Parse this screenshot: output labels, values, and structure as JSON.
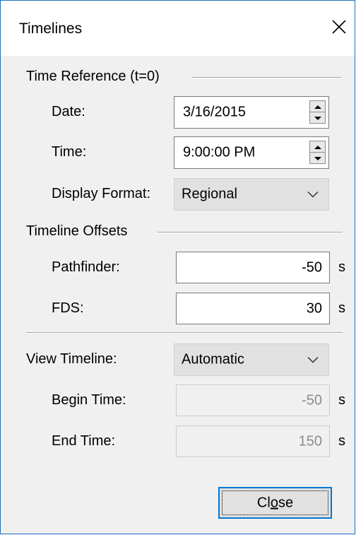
{
  "window": {
    "title": "Timelines",
    "close_icon": "close-icon"
  },
  "time_reference": {
    "header": "Time Reference (t=0)",
    "date_label": "Date:",
    "date_value": "3/16/2015",
    "time_label": "Time:",
    "time_value": "9:00:00 PM",
    "display_format_label": "Display Format:",
    "display_format_value": "Regional"
  },
  "timeline_offsets": {
    "header": "Timeline Offsets",
    "pathfinder_label": "Pathfinder:",
    "pathfinder_value": "-50",
    "pathfinder_unit": "s",
    "fds_label": "FDS:",
    "fds_value": "30",
    "fds_unit": "s"
  },
  "view": {
    "view_timeline_label": "View Timeline:",
    "view_timeline_value": "Automatic",
    "begin_time_label": "Begin Time:",
    "begin_time_value": "-50",
    "begin_time_unit": "s",
    "end_time_label": "End Time:",
    "end_time_value": "150",
    "end_time_unit": "s"
  },
  "buttons": {
    "close_pre": "Cl",
    "close_mnemonic": "o",
    "close_post": "se"
  },
  "colors": {
    "window_border": "#1f6fbf",
    "dialog_bg": "#f0f0f0",
    "focus_border": "#0078d7"
  }
}
